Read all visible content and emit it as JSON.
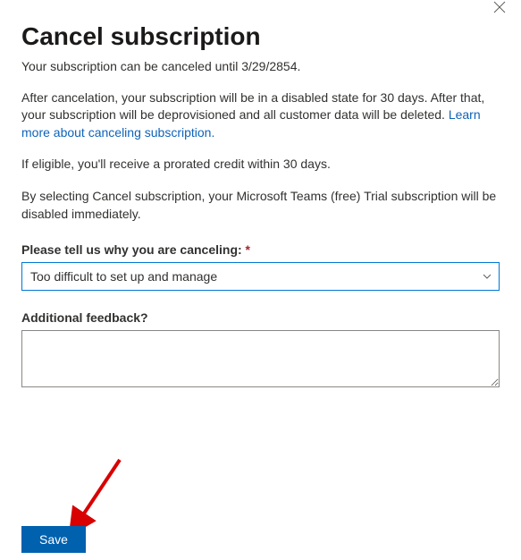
{
  "title": "Cancel subscription",
  "subhead": "Your subscription can be canceled until 3/29/2854.",
  "para1_a": "After cancelation, your subscription will be in a disabled state for 30 days. After that, your subscription will be deprovisioned and all customer data will be deleted. ",
  "para1_link": "Learn more about canceling subscription.",
  "para2": "If eligible, you'll receive a prorated credit within 30 days.",
  "para3": "By selecting Cancel subscription, your Microsoft Teams (free) Trial subscription will be disabled immediately.",
  "form": {
    "reason_label": "Please tell us why you are canceling:",
    "reason_value": "Too difficult to set up and manage",
    "feedback_label": "Additional feedback?",
    "feedback_value": ""
  },
  "buttons": {
    "save": "Save"
  }
}
